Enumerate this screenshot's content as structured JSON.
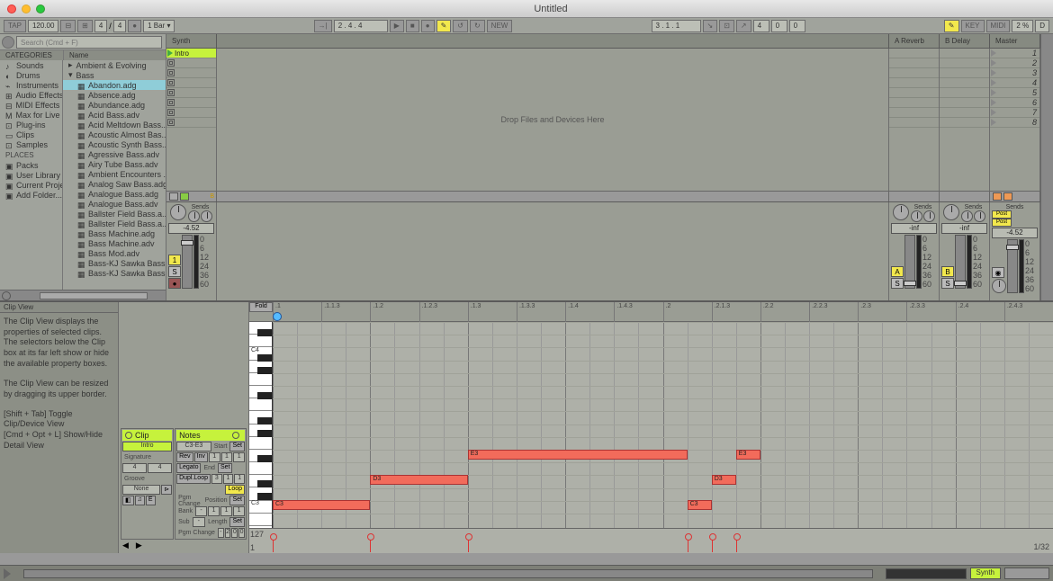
{
  "window": {
    "title": "Untitled"
  },
  "controlbar": {
    "tap": "TAP",
    "tempo": "120.00",
    "timesig1": "4",
    "timesig2": "4",
    "metro": "●",
    "quantize": "1 Bar ▾",
    "barsbeats": "2 . 4 . 4",
    "play": "▶",
    "stop": "■",
    "rec": "●",
    "auto": "✎",
    "loop": "↻",
    "new": "NEW",
    "loc": "3 . 1 . 1",
    "punch1": "↘",
    "punch2": "⊡",
    "punch3": "↗",
    "len1": "4",
    "len2": "0",
    "len3": "0",
    "draw": "✎",
    "key": "KEY",
    "midi": "MIDI",
    "cpu": "2 %",
    "disk": "D"
  },
  "search": {
    "placeholder": "Search (Cmd + F)"
  },
  "browser": {
    "catHdr": "CATEGORIES",
    "nameHdr": "Name",
    "placesHdr": "PLACES",
    "categories": [
      {
        "l": "Sounds",
        "sel": true
      },
      {
        "l": "Drums"
      },
      {
        "l": "Instruments"
      },
      {
        "l": "Audio Effects"
      },
      {
        "l": "MIDI Effects"
      },
      {
        "l": "Max for Live"
      },
      {
        "l": "Plug-ins"
      },
      {
        "l": "Clips"
      },
      {
        "l": "Samples"
      }
    ],
    "places": [
      {
        "l": "Packs"
      },
      {
        "l": "User Library"
      },
      {
        "l": "Current Project"
      },
      {
        "l": "Add Folder..."
      }
    ],
    "col2": [
      {
        "l": "Ambient & Evolving",
        "folder": true
      },
      {
        "l": "Bass",
        "folder": true,
        "open": true
      }
    ],
    "files": [
      "Abandon.adg",
      "Absence.adg",
      "Abundance.adg",
      "Acid Bass.adv",
      "Acid Meltdown Bass....",
      "Acoustic Almost Bas...",
      "Acoustic Synth Bass...",
      "Agressive Bass.adv",
      "Airy Tube Bass.adv",
      "Ambient Encounters ...",
      "Analog Saw Bass.adg",
      "Analogue Bass.adg",
      "Analogue Bass.adv",
      "Ballster Field Bass.a...",
      "Ballster Field Bass.a...",
      "Bass Machine.adg",
      "Bass Machine.adv",
      "Bass Mod.adv",
      "Bass-KJ Sawka Bass...",
      "Bass-KJ Sawka Bass..."
    ],
    "selFile": "Abandon.adg"
  },
  "tracks": {
    "synth": "Synth",
    "drop": "Drop Files and Devices Here",
    "returnA": "A Reverb",
    "returnB": "B Delay",
    "master": "Master",
    "clipname": "Intro",
    "scenes": [
      "1",
      "2",
      "3",
      "4",
      "5",
      "6",
      "7",
      "8"
    ]
  },
  "mixer": {
    "sends": "Sends",
    "db": "-4.52",
    "inf": "-inf",
    "scale": [
      "0",
      "6",
      "12",
      "24",
      "36",
      "60"
    ],
    "btn1": "1",
    "S": "S",
    "A": "A",
    "B": "B",
    "post": "Post"
  },
  "info": {
    "title": "Clip View",
    "p1": "The Clip View displays the properties of selected clips. The selectors below the Clip box at its far left show or hide the available property boxes.",
    "p2": "The Clip View can be resized by dragging its upper border.",
    "p3": "[Shift + Tab] Toggle Clip/Device View\n[Cmd + Opt + L] Show/Hide Detail View"
  },
  "clip_inspector": {
    "clip": "Clip",
    "notes": "Notes",
    "name": "Intro",
    "range": "C3-E3",
    "sig": "Signature",
    "sig1": "4",
    "sig2": "4",
    "groove": "Groove",
    "none": "None",
    "start": "Start",
    "end": "End",
    "rev": "Rev",
    "inv": "Inv",
    "legato": "Legato",
    "duploop": "Dupl.Loop",
    "loop": "Loop",
    "pos": "Position",
    "len": "Length",
    "pgm": "Pgm Change",
    "bank": "Bank",
    "sub": "Sub",
    "s1": "1",
    "s2": "1",
    "s3": "1",
    "e1": "3",
    "e2": "1",
    "e3": "1",
    "set": "Set"
  },
  "midiview": {
    "fold": "Fold",
    "ticks": [
      ".1",
      ".1.1.3",
      ".1.2",
      ".1.2.3",
      ".1.3",
      ".1.3.3",
      ".1.4",
      ".1.4.3",
      ".2",
      ".2.1.3",
      ".2.2",
      ".2.2.3",
      ".2.3",
      ".2.3.3",
      ".2.4",
      ".2.4.3"
    ],
    "oct_c4": "C4",
    "oct_c3": "C3",
    "v127": "127",
    "v1": "1",
    "zoom": "1/32"
  },
  "chart_data": {
    "type": "table",
    "description": "MIDI note clip, 2 bars, 4/4",
    "notes": [
      {
        "pitch": "C3",
        "start_beat": 1.0,
        "length_beats": 1.0
      },
      {
        "pitch": "D3",
        "start_beat": 2.0,
        "length_beats": 1.0
      },
      {
        "pitch": "E3",
        "start_beat": 3.0,
        "length_beats": 2.25
      },
      {
        "pitch": "C3",
        "start_beat": 5.25,
        "length_beats": 0.25
      },
      {
        "pitch": "D3",
        "start_beat": 5.5,
        "length_beats": 0.25
      },
      {
        "pitch": "E3",
        "start_beat": 5.75,
        "length_beats": 0.25
      }
    ],
    "velocity_default": 100
  },
  "status": {
    "synth": "Synth"
  }
}
